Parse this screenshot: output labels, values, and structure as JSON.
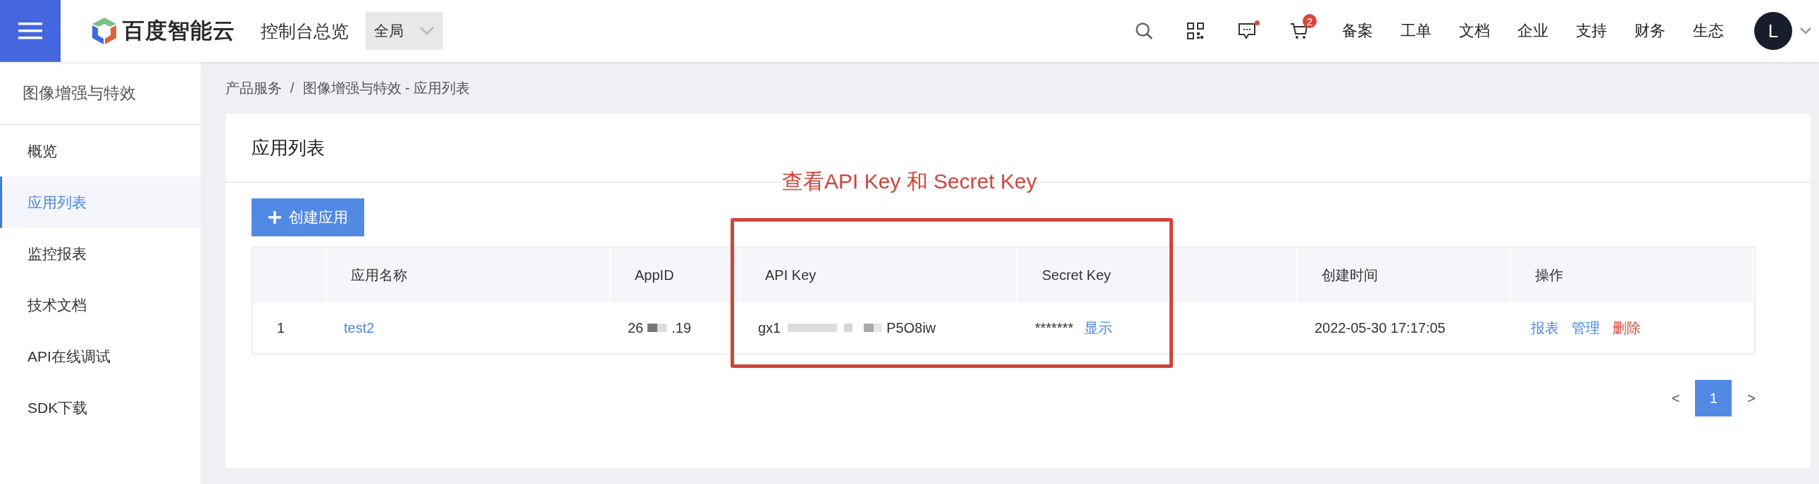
{
  "topbar": {
    "logo_text": "百度智能云",
    "console_title": "控制台总览",
    "region": {
      "label": "全局"
    },
    "message_unread": true,
    "cart_badge": "2",
    "nav_links": [
      "备案",
      "工单",
      "文档",
      "企业",
      "支持",
      "财务",
      "生态"
    ],
    "avatar": "L"
  },
  "sidebar": {
    "title": "图像增强与特效",
    "items": [
      {
        "label": "概览",
        "selected": false
      },
      {
        "label": "应用列表",
        "selected": true
      },
      {
        "label": "监控报表",
        "selected": false
      },
      {
        "label": "技术文档",
        "selected": false
      },
      {
        "label": "API在线调试",
        "selected": false
      },
      {
        "label": "SDK下载",
        "selected": false
      }
    ]
  },
  "breadcrumb": {
    "items": [
      "产品服务",
      "图像增强与特效 - 应用列表"
    ],
    "separator": "/"
  },
  "card": {
    "title": "应用列表",
    "create_button": "创建应用",
    "annotation": "查看API Key 和 Secret Key",
    "table": {
      "columns": [
        "应用名称",
        "AppID",
        "API Key",
        "Secret Key",
        "创建时间",
        "操作"
      ],
      "rows": [
        {
          "index": "1",
          "name": "test2",
          "app_id": {
            "start": "26",
            "end": ".19"
          },
          "api_key": {
            "start": "gx1",
            "end": "P5O8iw"
          },
          "secret_key": "*******",
          "show_link": "显示",
          "created": "2022-05-30 17:17:05",
          "actions": [
            {
              "label": "报表",
              "kind": "link"
            },
            {
              "label": "管理",
              "kind": "link"
            },
            {
              "label": "删除",
              "kind": "danger"
            }
          ]
        }
      ]
    },
    "pagination": {
      "prev": "<",
      "pages": [
        {
          "label": "1",
          "selected": true
        }
      ],
      "next": ">"
    }
  }
}
